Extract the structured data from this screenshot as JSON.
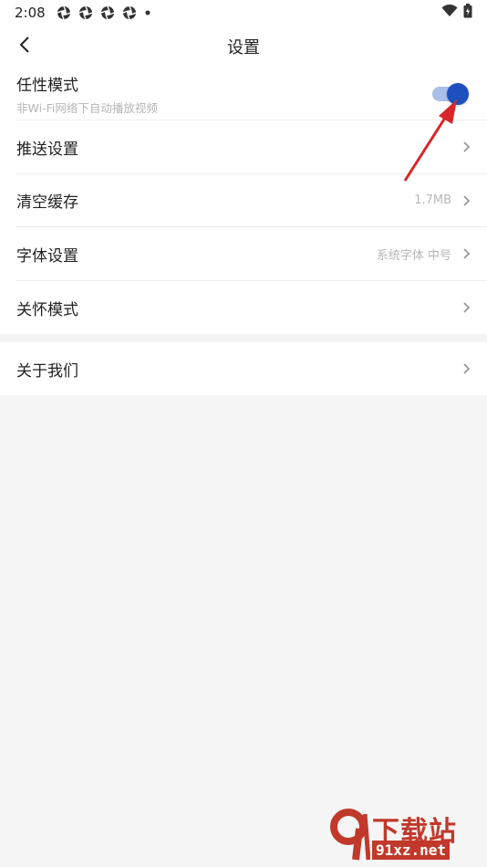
{
  "status_bar": {
    "time": "2:08",
    "left_icons": [
      "aperture-icon",
      "aperture-icon",
      "aperture-icon",
      "aperture-icon",
      "dot-icon"
    ],
    "right_icons": [
      "wifi-icon",
      "battery-icon"
    ]
  },
  "header": {
    "back_icon": "chevron-left-icon",
    "title": "设置"
  },
  "settings": {
    "items": [
      {
        "label": "任性模式",
        "sub": "非Wi-Fi网络下自动播放视频",
        "control": "toggle",
        "toggle_on": true
      },
      {
        "label": "推送设置",
        "value": "",
        "control": "chevron"
      },
      {
        "label": "清空缓存",
        "value": "1.7MB",
        "control": "chevron"
      },
      {
        "label": "字体设置",
        "value": "系统字体 中号",
        "control": "chevron"
      },
      {
        "label": "关怀模式",
        "value": "",
        "control": "chevron"
      }
    ],
    "about": {
      "label": "关于我们",
      "control": "chevron"
    }
  },
  "colors": {
    "accent": "#1e4fbf",
    "toggle_track": "#a9bfe7",
    "annotation_arrow": "#d9262b",
    "background": "#f5f5f5"
  },
  "watermark": {
    "text_top": "下载站",
    "text_bottom": "91xz.net"
  }
}
